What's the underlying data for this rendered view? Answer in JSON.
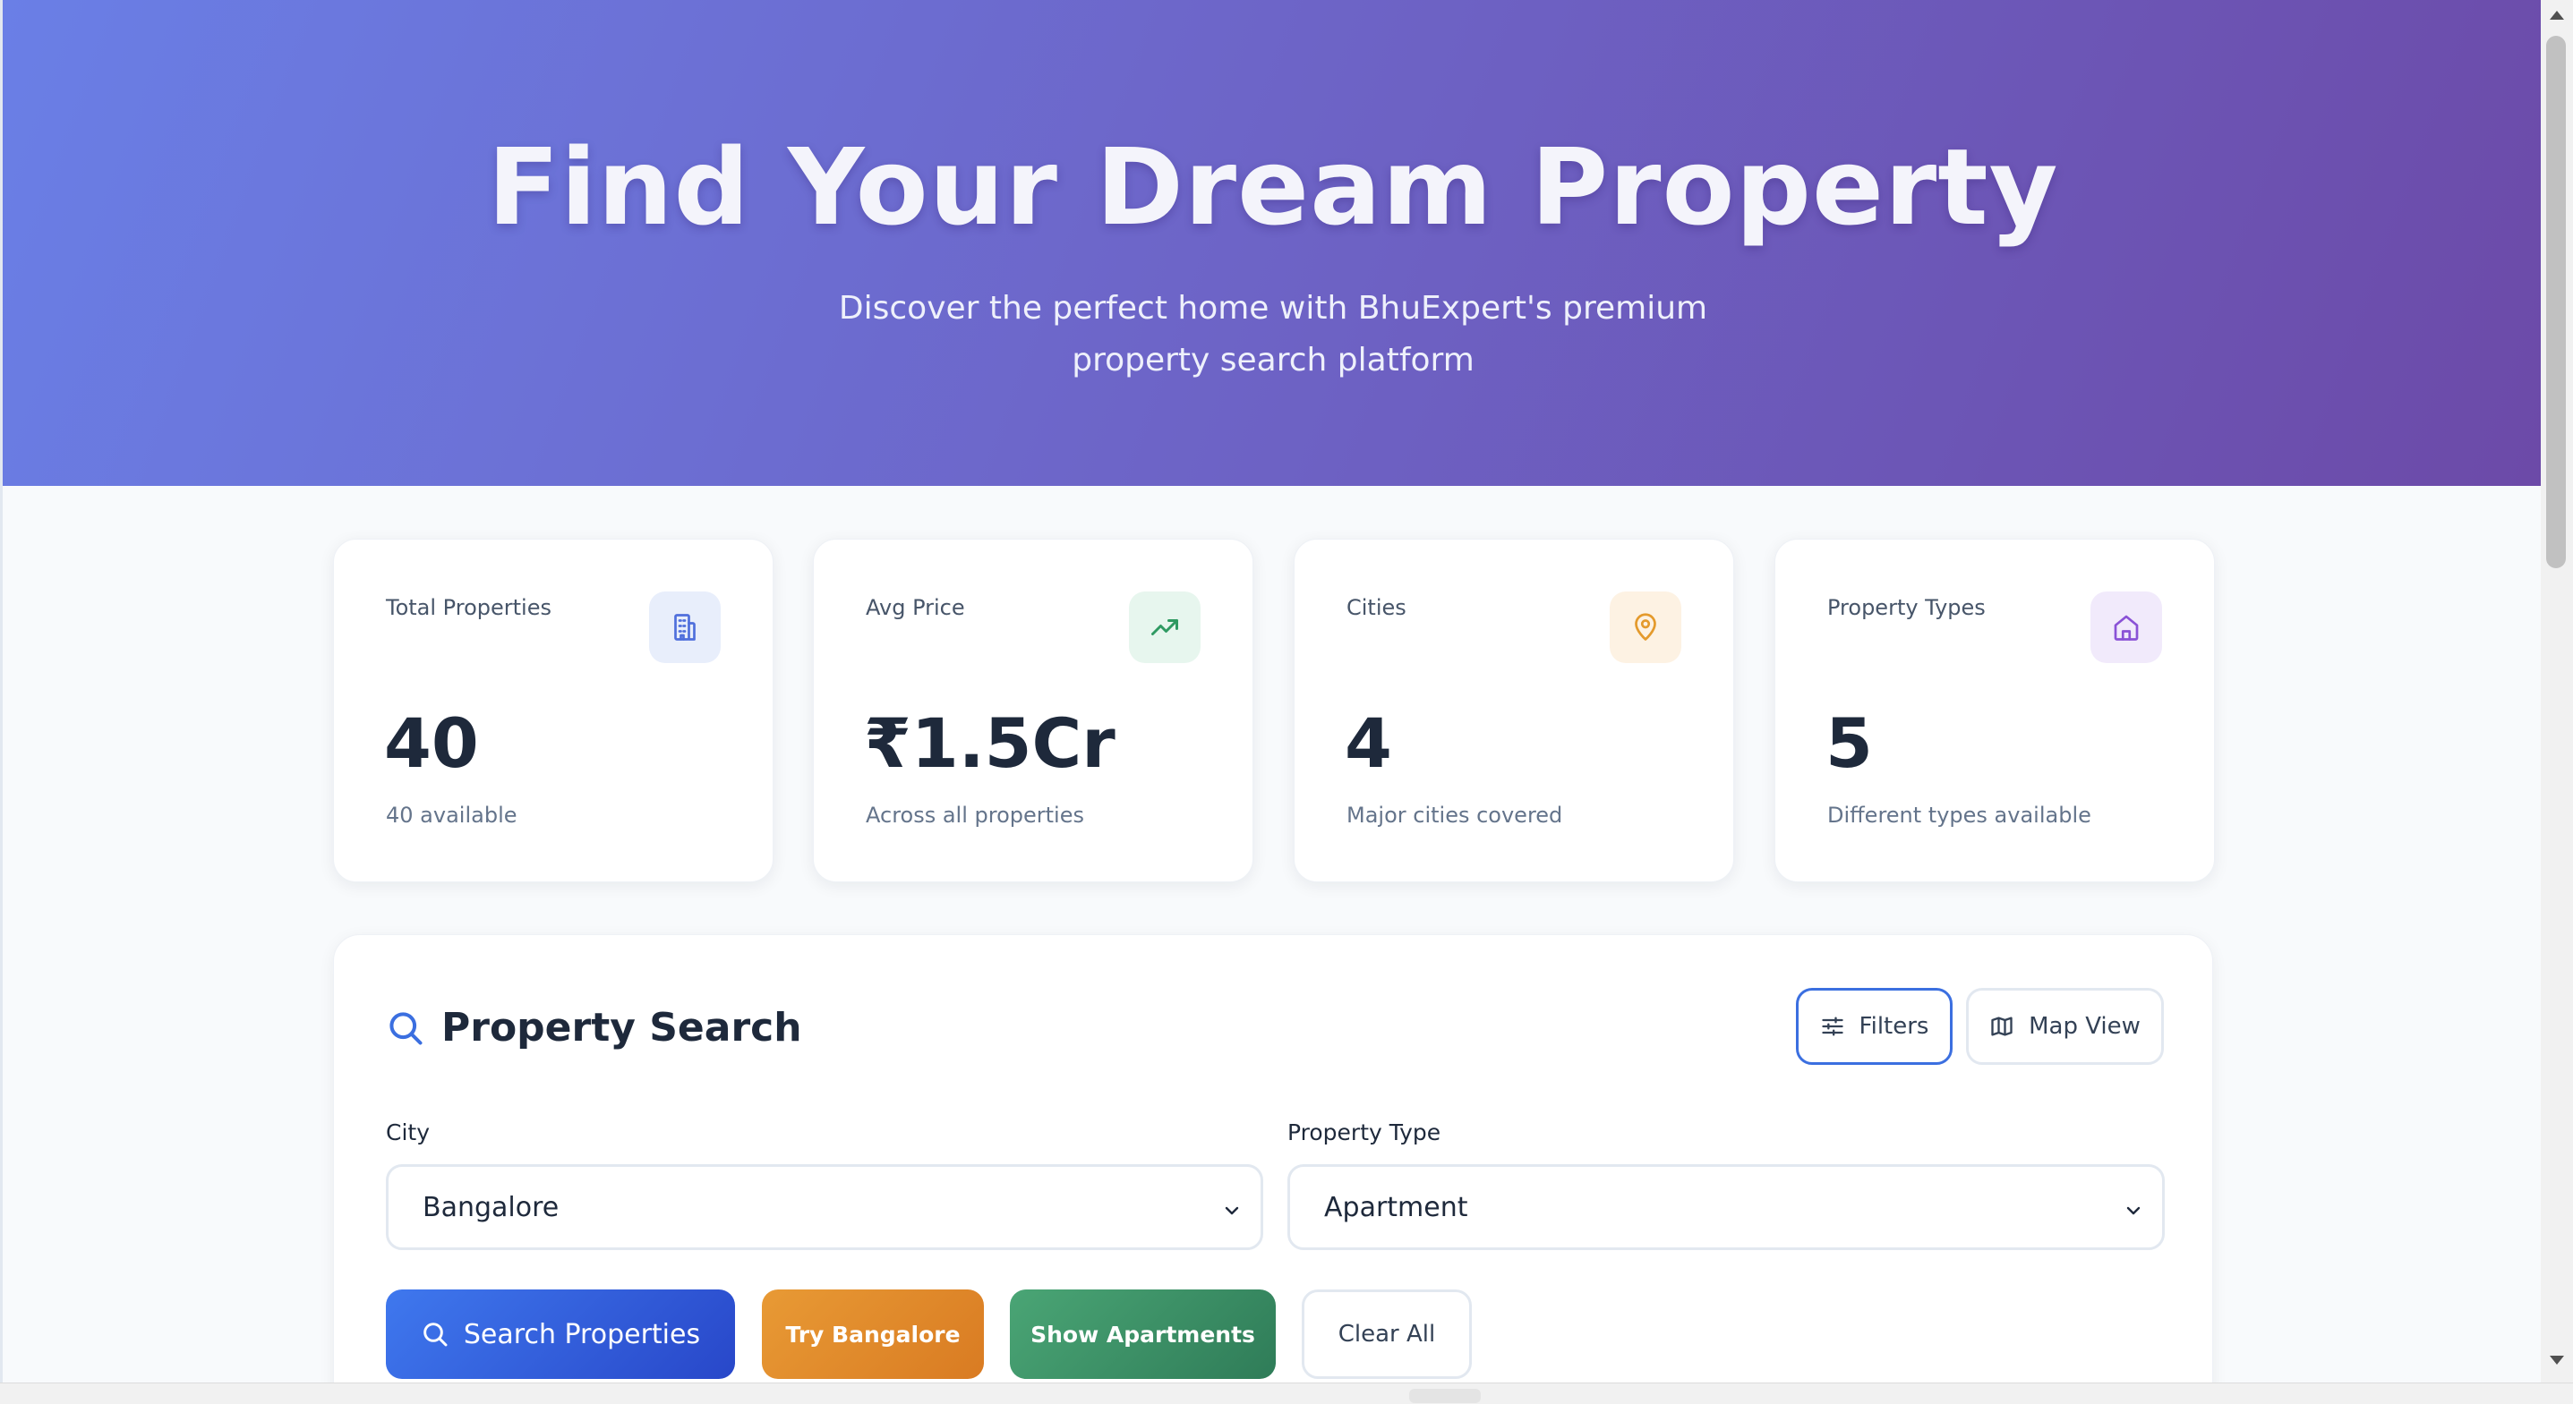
{
  "hero": {
    "title": "Find Your Dream Property",
    "subtitle": "Discover the perfect home with BhuExpert's premium property search platform"
  },
  "stats": [
    {
      "label": "Total Properties",
      "value": "40",
      "desc": "40 available",
      "icon": "building-icon",
      "icon_color": "#4f6fdc",
      "icon_bg": "#e8eefb"
    },
    {
      "label": "Avg Price",
      "value": "₹1.5Cr",
      "desc": "Across all properties",
      "icon": "trending-up-icon",
      "icon_color": "#2f9a62",
      "icon_bg": "#e7f6ee"
    },
    {
      "label": "Cities",
      "value": "4",
      "desc": "Major cities covered",
      "icon": "map-pin-icon",
      "icon_color": "#e49a2c",
      "icon_bg": "#fdf2e3"
    },
    {
      "label": "Property Types",
      "value": "5",
      "desc": "Different types available",
      "icon": "home-icon",
      "icon_color": "#8a52d6",
      "icon_bg": "#f1eafb"
    }
  ],
  "search": {
    "title": "Property Search",
    "filters_label": "Filters",
    "map_view_label": "Map View",
    "city_label": "City",
    "city_value": "Bangalore",
    "type_label": "Property Type",
    "type_value": "Apartment",
    "search_button": "Search Properties",
    "try_bangalore": "Try Bangalore",
    "show_apartments": "Show Apartments",
    "clear_all": "Clear All"
  },
  "colors": {
    "hero_start": "#6a7fe6",
    "hero_end": "#6c4aa8",
    "primary": "#3b6fe0"
  }
}
